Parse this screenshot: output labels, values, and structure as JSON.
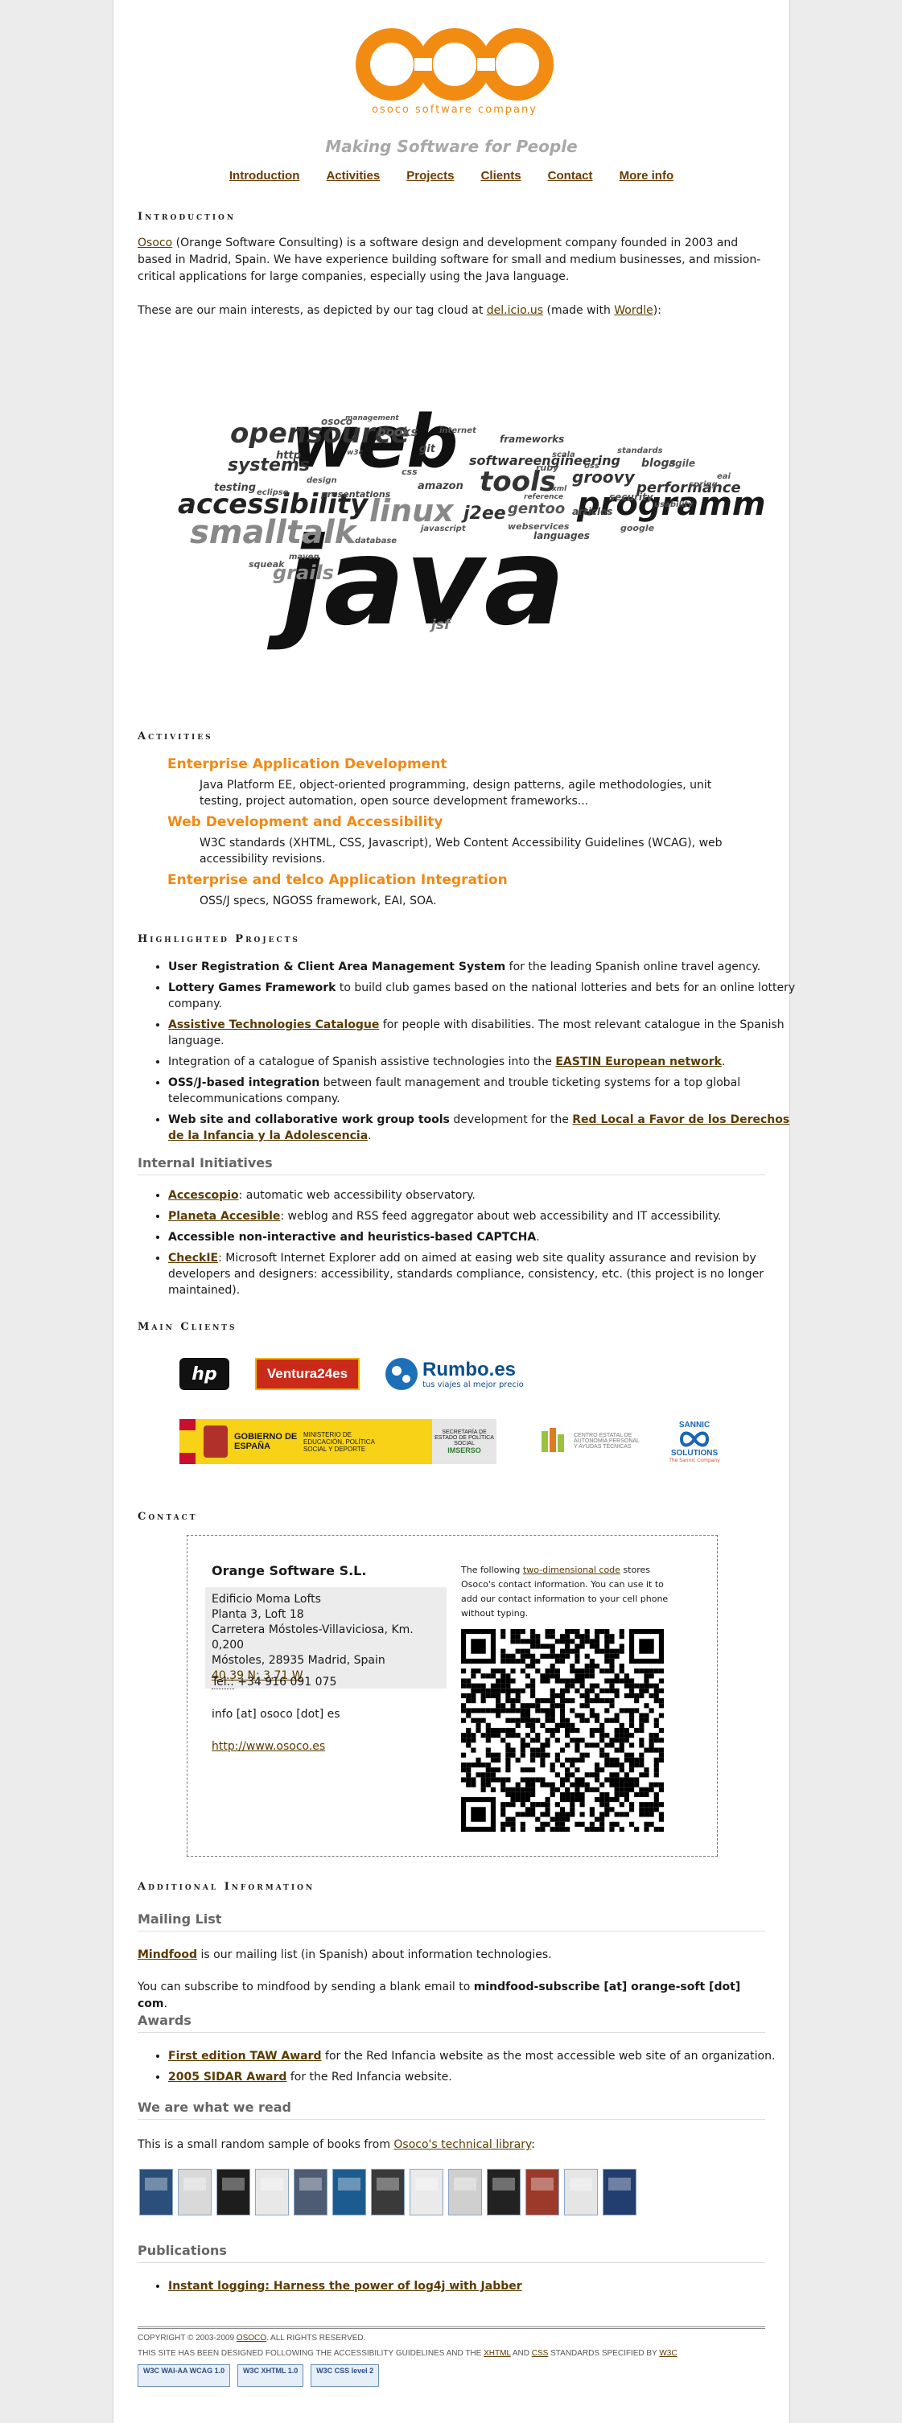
{
  "logo": {
    "text": "osoco software company",
    "color": "#f28b12"
  },
  "tagline": "Making Software for People",
  "nav": [
    "Introduction",
    "Activities",
    "Projects",
    "Clients",
    "Contact",
    "More info"
  ],
  "intro": {
    "heading": "Introduction",
    "p1_link": "Osoco",
    "p1_rest": " (Orange Software Consulting) is a software design and development company founded in 2003 and based in Madrid, Spain. We have experience building software for small and medium businesses, and mission-critical applications for large companies, especially using the Java language.",
    "p2_a": "These are our main interests, as depicted by our tag cloud at ",
    "p2_link1": "del.icio.us",
    "p2_b": " (made with ",
    "p2_link2": "Wordle",
    "p2_c": "):"
  },
  "cloud_words": [
    "java",
    "web",
    "programming",
    "smalltalk",
    "accessibility",
    "opensource",
    "linux",
    "tools",
    "systems",
    "grails",
    "j2ee",
    "gentoo",
    "groovy",
    "performance",
    "blogs",
    "agile",
    "frameworks",
    "softwareengineering",
    "amazon",
    "presentations",
    "books",
    "languages",
    "articles",
    "jsf",
    "testing",
    "http",
    "squeak",
    "git",
    "osoco",
    "google",
    "security",
    "webservices",
    "standards",
    "css",
    "javascript",
    "ruby",
    "scala",
    "management",
    "design",
    "database",
    "internet",
    "reference",
    "oss",
    "eclipse",
    "spring",
    "eai",
    "maven",
    "usability",
    "w3c",
    "xml"
  ],
  "activities": {
    "heading": "Activities",
    "items": [
      {
        "title": "Enterprise Application Development",
        "desc": "Java Platform EE, object-oriented programming, design patterns, agile methodologies, unit testing, project automation, open source development frameworks..."
      },
      {
        "title": "Web Development and Accessibility",
        "desc": "W3C standards (XHTML, CSS, Javascript), Web Content Accessibility Guidelines (WCAG), web accessibility revisions."
      },
      {
        "title": "Enterprise and telco Application Integration",
        "desc": "OSS/J specs, NGOSS framework, EAI, SOA."
      }
    ]
  },
  "projects": {
    "heading": "Highlighted Projects",
    "items": [
      {
        "bold": "User Registration & Client Area Management System",
        "rest": " for the leading Spanish online travel agency."
      },
      {
        "bold": "Lottery Games Framework",
        "rest": " to build club games based on the national lotteries and bets for an online lottery company."
      },
      {
        "link": "Assistive Technologies Catalogue",
        "rest": " for people with disabilities. The most relevant catalogue in the Spanish language."
      },
      {
        "pre": "Integration of a catalogue of Spanish assistive technologies into the ",
        "link": "EASTIN European network",
        "rest": "."
      },
      {
        "bold": "OSS/J-based integration",
        "rest": " between fault management and trouble ticketing systems for a top global telecommunications company."
      },
      {
        "bold": "Web site and collaborative work group tools",
        "pre2": " development for the ",
        "link": "Red Local a Favor de los Derechos de la Infancia y la Adolescencia",
        "rest": "."
      }
    ],
    "internal_heading": "Internal Initiatives",
    "internal": [
      {
        "link": "Accescopio",
        "rest": ": automatic web accessibility observatory."
      },
      {
        "link": "Planeta Accesible",
        "rest": ": weblog and RSS feed aggregator about web accessibility and IT accessibility."
      },
      {
        "bold": "Accessible non-interactive and heuristics-based CAPTCHA",
        "rest": "."
      },
      {
        "link": "CheckIE",
        "rest": ": Microsoft Internet Explorer add on aimed at easing web site quality assurance and revision by developers and designers: accessibility, standards compliance, consistency, etc. (this project is no longer maintained)."
      }
    ]
  },
  "clients": {
    "heading": "Main Clients",
    "logos": [
      "hp",
      "Ventura24es",
      "Rumbo.es",
      "tus viajes al mejor precio",
      "GOBIERNO DE ESPAÑA",
      "MINISTERIO DE EDUCACIÓN, POLÍTICA SOCIAL Y DEPORTE",
      "SECRETARÍA DE ESTADO DE POLÍTICA SOCIAL",
      "IMSERSO",
      "CENTRO ESTATAL DE AUTONOMÍA PERSONAL Y AYUDAS TÉCNICAS",
      "SANNIC",
      "SOLUTIONS",
      "The Sannic Company"
    ]
  },
  "contact": {
    "heading": "Contact",
    "company": "Orange Software S.L.",
    "address": [
      "Edificio Moma Lofts",
      "Planta 3, Loft 18",
      "Carretera Móstoles-Villaviciosa, Km. 0,200",
      "Móstoles, 28935 Madrid, Spain"
    ],
    "geo": "40.39 N; 3.71 W",
    "tel_label": "Tel.:",
    "tel": "+34 916 091 075",
    "email": "info [at] osoco [dot] es",
    "url": "http://www.osoco.es",
    "qr_a": "The following ",
    "qr_link": "two-dimensional code",
    "qr_b": " stores Osoco's contact information. You can use it to add our contact information to your cell phone without typing."
  },
  "additional": {
    "heading": "Additional Information",
    "mailing_heading": "Mailing List",
    "mailing_link": "Mindfood",
    "mailing_p1": " is our mailing list (in Spanish) about information technologies.",
    "mailing_p2a": "You can subscribe to mindfood by sending a blank email to ",
    "mailing_p2b": "mindfood-subscribe [at] orange-soft [dot] com",
    "mailing_p2c": ".",
    "awards_heading": "Awards",
    "awards": [
      {
        "link": "First edition TAW Award",
        "rest": " for the Red Infancia website as the most accessible web site of an organization."
      },
      {
        "link": "2005 SIDAR Award",
        "rest": " for the Red Infancia website."
      }
    ],
    "read_heading": "We are what we read",
    "read_a": "This is a small random sample of books from ",
    "read_link": "Osoco's technical library",
    "read_b": ":",
    "book_colors": [
      "#2a4f7a",
      "#d9d9d9",
      "#1d1d1d",
      "#e8e8e8",
      "#4d5b73",
      "#1c5b8f",
      "#3a3a3a",
      "#eaeaea",
      "#cfcfcf",
      "#222222",
      "#9b3a2a",
      "#e5e5e5",
      "#223d70"
    ],
    "pubs_heading": "Publications",
    "pub": "Instant logging: Harness the power of log4j with Jabber"
  },
  "footer": {
    "copy": "COPYRIGHT © 2003-2009 ",
    "copy_link": "OSOCO",
    "copy_b": ". ALL RIGHTS RESERVED.",
    "line2a": "THIS SITE HAS BEEN DESIGNED FOLLOWING THE ACCESSIBILITY GUIDELINES AND THE ",
    "xhtml": "XHTML",
    "and": " AND ",
    "css": "CSS",
    "line2b": " STANDARDS SPECIFIED BY ",
    "w3c": "W3C",
    "badges": [
      "W3C WAI-AA WCAG 1.0",
      "W3C XHTML 1.0",
      "W3C CSS level 2"
    ]
  }
}
